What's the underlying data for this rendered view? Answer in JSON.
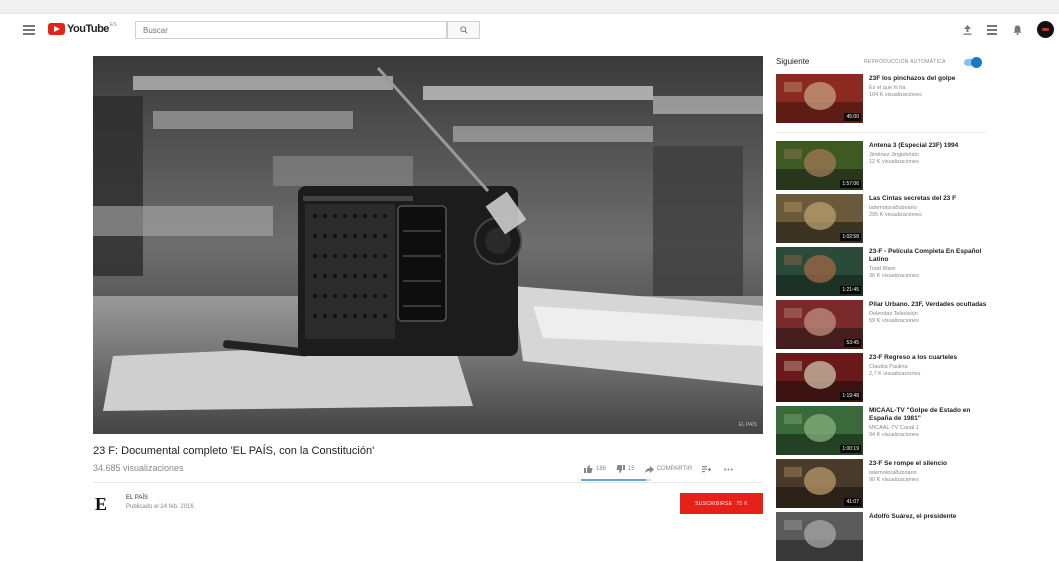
{
  "header": {
    "logo_text": "YouTube",
    "logo_region": "ES",
    "search_placeholder": "Buscar"
  },
  "video": {
    "title": "23 F: Documental completo 'EL PAÍS, con la Constitución'",
    "views": "34.685 visualizaciones",
    "watermark": "EL PAÍS",
    "likes": "186",
    "dislikes": "15",
    "share_label": "COMPARTIR",
    "like_ratio": 0.93
  },
  "channel": {
    "logo_letter": "E",
    "name": "EL PAÍS",
    "published": "Publicado el 24 feb. 2016",
    "subscribe_label": "SUSCRIBIRSE",
    "subscriber_count": "75 K"
  },
  "sidebar": {
    "next_label": "Siguiente",
    "autoplay_label": "REPRODUCCIÓN AUTOMÁTICA",
    "items": [
      {
        "title": "23F los pinchazos del golpe",
        "channel": "Es el que hi ha",
        "views": "104 K visualizaciones",
        "duration": "45:00"
      },
      {
        "title": "Antena 3 (Especial 23F) 1994",
        "channel": "Jiménez Jingiebrlalo",
        "views": "12 K visualizaciones",
        "duration": "1:57:06"
      },
      {
        "title": "Las Cintas secretas del 23 F",
        "channel": "tatemotora8uboario",
        "views": "295 K visualizaciones",
        "duration": "1:02:58"
      },
      {
        "title": "23-F - Película Completa En Español Latino",
        "channel": "Todd Ware",
        "views": "36 K visualizaciones",
        "duration": "1:21:45"
      },
      {
        "title": "Pilar Urbano. 23F, Verdades ocultadas",
        "channel": "Delendas Televisión",
        "views": "59 K visualizaciones",
        "duration": "53:45"
      },
      {
        "title": "23-F Regreso a los cuarteles",
        "channel": "Claudia Paulina",
        "views": "2,7 K visualizaciones",
        "duration": "1:19:48"
      },
      {
        "title": "MICAAL-TV \"Golpe de Estado en España de 1981\"",
        "channel": "MICAAL-TV Canal 1",
        "views": "94 K visualizaciones",
        "duration": "1:00:19"
      },
      {
        "title": "23-F Se rompe el silencio",
        "channel": "tatemotora8uboario",
        "views": "90 K visualizaciones",
        "duration": "41:07"
      },
      {
        "title": "Adolfo Suárez, el presidente",
        "channel": "",
        "views": "",
        "duration": ""
      }
    ]
  },
  "colors": {
    "brand_red": "#e62117",
    "toggle_blue": "#167ac6"
  }
}
